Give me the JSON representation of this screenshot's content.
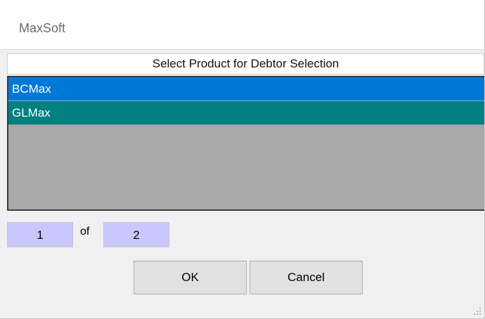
{
  "window": {
    "title": "MaxSoft"
  },
  "list": {
    "header": "Select Product for Debtor Selection",
    "items": [
      {
        "label": "BCMax",
        "state": "selected",
        "color": "#0078d7"
      },
      {
        "label": "GLMax",
        "state": "highlighted",
        "color": "#008080"
      }
    ],
    "empty_area_color": "#a9a9a9"
  },
  "pager": {
    "current": "1",
    "of_label": "of",
    "total": "2",
    "box_color": "#c8c8ff"
  },
  "buttons": {
    "ok_label": "OK",
    "cancel_label": "Cancel"
  },
  "icons": {
    "resize_grip": "resize-grip-icon"
  }
}
